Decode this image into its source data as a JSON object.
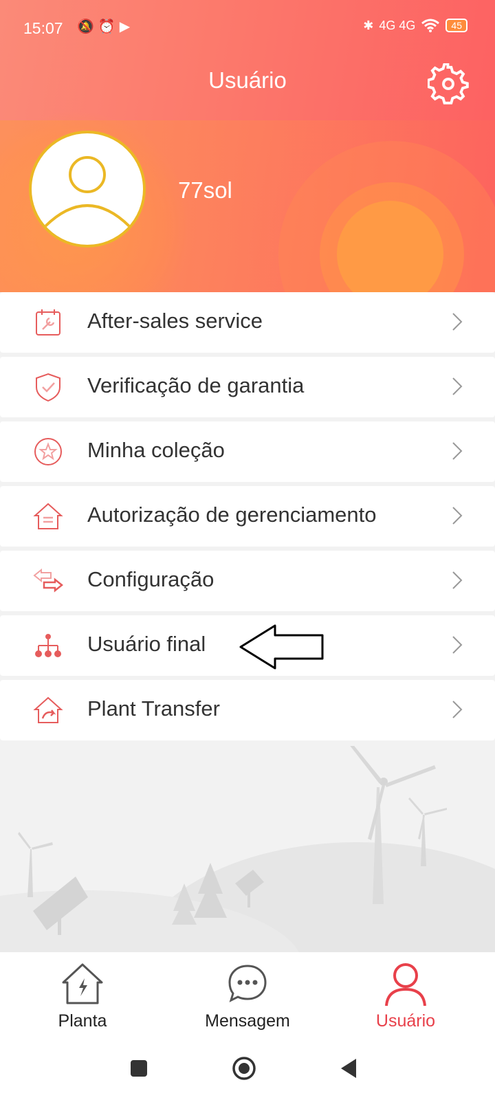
{
  "status_bar": {
    "time": "15:07",
    "left_icons": "🔕⏰▶",
    "network": "4G 4G",
    "battery": "45"
  },
  "header": {
    "title": "Usuário",
    "username": "77sol"
  },
  "menu": {
    "items": [
      {
        "label": "After-sales service",
        "icon": "wrench-calendar-icon"
      },
      {
        "label": "Verificação de garantia",
        "icon": "shield-check-icon"
      },
      {
        "label": "Minha coleção",
        "icon": "star-circle-icon"
      },
      {
        "label": "Autorização de gerenciamento",
        "icon": "house-document-icon"
      },
      {
        "label": "Configuração",
        "icon": "swap-arrows-icon"
      },
      {
        "label": "Usuário final",
        "icon": "hierarchy-icon"
      },
      {
        "label": "Plant Transfer",
        "icon": "house-transfer-icon"
      }
    ]
  },
  "tabbar": {
    "tabs": [
      {
        "label": "Planta",
        "icon": "house-bolt-icon",
        "active": false
      },
      {
        "label": "Mensagem",
        "icon": "chat-bubble-icon",
        "active": false
      },
      {
        "label": "Usuário",
        "icon": "user-icon",
        "active": true
      }
    ]
  },
  "colors": {
    "accent": "#e8404a",
    "header_start": "#fb8a78",
    "header_end": "#fd5f61",
    "avatar_ring": "#ebb825",
    "icon_red": "#e65c5c"
  }
}
